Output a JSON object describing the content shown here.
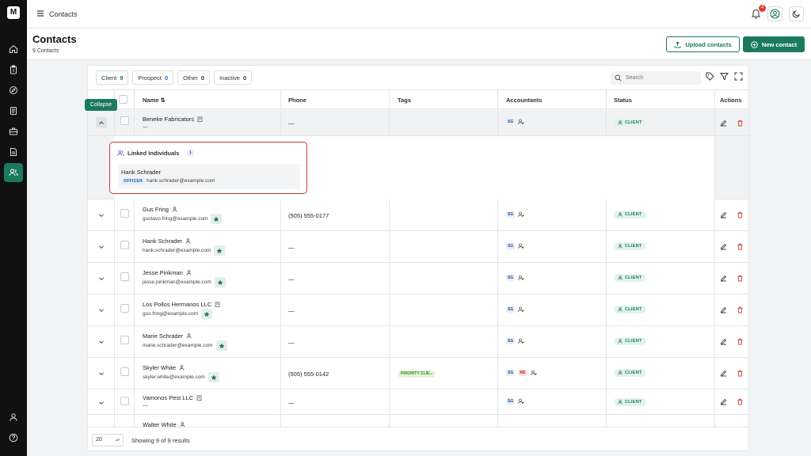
{
  "app": {
    "logo": "M",
    "title": "Contacts",
    "notifications": "4"
  },
  "sidebar": [
    "home-icon",
    "clipboard-icon",
    "compass-icon",
    "document-list-icon",
    "briefcase-icon",
    "file-text-icon",
    "users-icon"
  ],
  "page": {
    "title": "Contacts",
    "subtitle": "9 Contacts",
    "upload_label": "Upload contacts",
    "new_label": "New contact"
  },
  "filters": [
    {
      "label": "Client",
      "count": "9"
    },
    {
      "label": "Prospect",
      "count": "0"
    },
    {
      "label": "Other",
      "count": "0"
    },
    {
      "label": "Inactive",
      "count": "0"
    }
  ],
  "search": {
    "placeholder": "Search"
  },
  "columns": {
    "name": "Name ⇅",
    "phone": "Phone",
    "tags": "Tags",
    "accountants": "Accountants",
    "status": "Status",
    "actions": "Actions"
  },
  "tooltip": "Collapse",
  "rows": [
    {
      "name": "Beneke Fabricators",
      "email": "—",
      "phone": "—",
      "status": "CLIENT",
      "accountants": [
        "SG"
      ]
    },
    {
      "name": "Gus Fring",
      "email": "gustavo.fring@example.com",
      "phone": "(505) 555-0177",
      "status": "CLIENT",
      "accountants": [
        "SG"
      ]
    },
    {
      "name": "Hank Schrader",
      "email": "hank.schrader@example.com",
      "phone": "—",
      "status": "CLIENT",
      "accountants": [
        "SG"
      ]
    },
    {
      "name": "Jesse Pinkman",
      "email": "jesse.pinkman@example.com",
      "phone": "—",
      "status": "CLIENT",
      "accountants": [
        "SG"
      ]
    },
    {
      "name": "Los Pollos Hermanos LLC",
      "email": "gus.fring@example.com",
      "phone": "—",
      "status": "CLIENT",
      "accountants": [
        "SG"
      ]
    },
    {
      "name": "Marie Schrader",
      "email": "marie.schrader@example.com",
      "phone": "—",
      "status": "CLIENT",
      "accountants": [
        "SG"
      ]
    },
    {
      "name": "Skyler White",
      "email": "skyler.white@example.com",
      "phone": "(505) 555-0142",
      "status": "CLIENT",
      "tag": "PRIORITY CLIE...",
      "accountants": [
        "SG",
        "ME"
      ]
    },
    {
      "name": "Vamonos Pest LLC",
      "email": "—",
      "phone": "—",
      "status": "CLIENT",
      "accountants": [
        "SG"
      ]
    },
    {
      "name": "Walter White"
    }
  ],
  "linked": {
    "title": "Linked Individuals",
    "count": "1",
    "name": "Hank Schrader",
    "role": "OFFICER",
    "email": "hank.schrader@example.com"
  },
  "footer": {
    "page_size": "20",
    "showing": "Showing 9 of 9 results"
  }
}
